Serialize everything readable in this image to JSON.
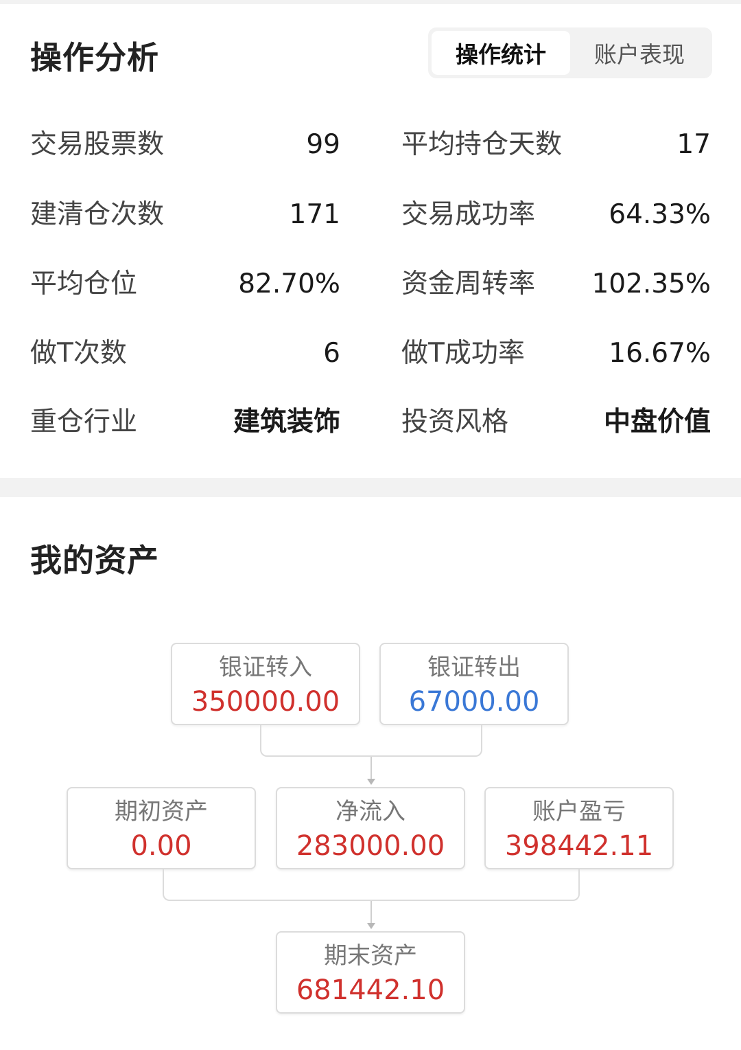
{
  "operations": {
    "title": "操作分析",
    "tabs": [
      {
        "label": "操作统计",
        "active": true
      },
      {
        "label": "账户表现",
        "active": false
      }
    ],
    "stats": [
      {
        "left_label": "交易股票数",
        "left_value": "99",
        "right_label": "平均持仓天数",
        "right_value": "17"
      },
      {
        "left_label": "建清仓次数",
        "left_value": "171",
        "right_label": "交易成功率",
        "right_value": "64.33%"
      },
      {
        "left_label": "平均仓位",
        "left_value": "82.70%",
        "right_label": "资金周转率",
        "right_value": "102.35%"
      },
      {
        "left_label": "做T次数",
        "left_value": "6",
        "right_label": "做T成功率",
        "right_value": "16.67%"
      },
      {
        "left_label": "重仓行业",
        "left_value": "建筑装饰",
        "right_label": "投资风格",
        "right_value": "中盘价值"
      }
    ]
  },
  "assets": {
    "title": "我的资产",
    "bank_in": {
      "label": "银证转入",
      "value": "350000.00"
    },
    "bank_out": {
      "label": "银证转出",
      "value": "67000.00"
    },
    "initial": {
      "label": "期初资产",
      "value": "0.00"
    },
    "net_inflow": {
      "label": "净流入",
      "value": "283000.00"
    },
    "pnl": {
      "label": "账户盈亏",
      "value": "398442.11"
    },
    "final": {
      "label": "期末资产",
      "value": "681442.10"
    }
  },
  "colors": {
    "positive": "#d0312d",
    "negative": "#3a78d6",
    "band": "#f2f2f2"
  }
}
